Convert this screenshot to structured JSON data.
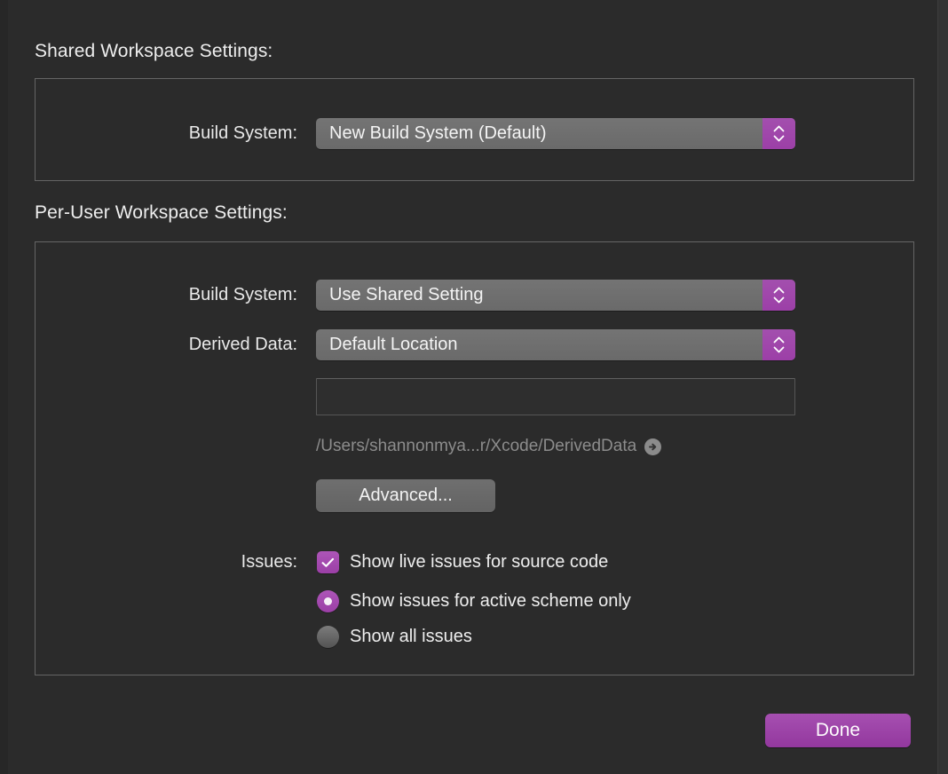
{
  "sections": {
    "shared": {
      "header": "Shared Workspace Settings:",
      "build_system": {
        "label": "Build System:",
        "value": "New Build System (Default)"
      }
    },
    "per_user": {
      "header": "Per-User Workspace Settings:",
      "build_system": {
        "label": "Build System:",
        "value": "Use Shared Setting"
      },
      "derived_data": {
        "label": "Derived Data:",
        "value": "Default Location",
        "custom_path_field_value": "",
        "custom_path_field_placeholder": "",
        "resolved_path": "/Users/shannonmya...r/Xcode/DerivedData"
      },
      "advanced_button": "Advanced...",
      "issues": {
        "label": "Issues:",
        "live_issues": {
          "label": "Show live issues for source code",
          "checked": true
        },
        "scope_options": [
          {
            "label": "Show issues for active scheme only",
            "selected": true
          },
          {
            "label": "Show all issues",
            "selected": false
          }
        ]
      }
    }
  },
  "footer": {
    "done_button": "Done"
  },
  "colors": {
    "accent_purple": "#9c3fa7",
    "window_background": "#2b2b2b",
    "panel_border": "#656565",
    "control_gray": "#6a6a6a",
    "muted_text": "#8c8c8c"
  },
  "icons": {
    "stepper_up": "chevron-up-icon",
    "stepper_down": "chevron-down-icon",
    "reveal": "arrow-right-circle-icon",
    "checkmark": "checkmark-icon"
  }
}
